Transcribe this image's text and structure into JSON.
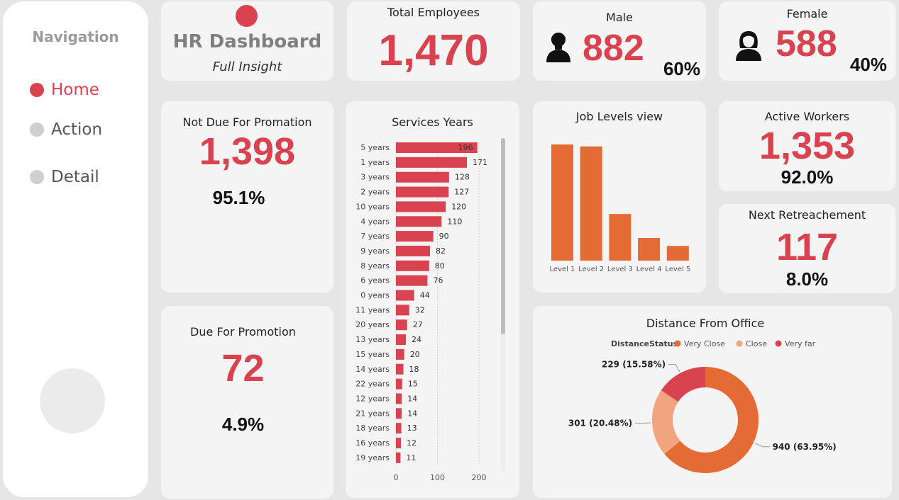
{
  "nav": {
    "title": "Navigation",
    "items": [
      {
        "label": "Home",
        "active": true
      },
      {
        "label": "Action",
        "active": false
      },
      {
        "label": "Detail",
        "active": false
      }
    ]
  },
  "header": {
    "title": "HR Dashboard",
    "subtitle": "Full Insight"
  },
  "total_employees": {
    "label": "Total Employees",
    "value": "1,470"
  },
  "male": {
    "label": "Male",
    "value": "882",
    "pct": "60%",
    "icon": "male-person-icon"
  },
  "female": {
    "label": "Female",
    "value": "588",
    "pct": "40%",
    "icon": "female-person-icon"
  },
  "not_due": {
    "label": "Not Due For Promation",
    "value": "1,398",
    "pct": "95.1%"
  },
  "due": {
    "label": "Due For Promotion",
    "value": "72",
    "pct": "4.9%"
  },
  "active_workers": {
    "label": "Active Workers",
    "value": "1,353",
    "pct": "92.0%"
  },
  "retirement": {
    "label": "Next Retreachement",
    "value": "117",
    "pct": "8.0%"
  },
  "colors": {
    "accent": "#d9434f",
    "orange": "#e56b35",
    "light_orange": "#f0a47f"
  },
  "chart_data": [
    {
      "type": "bar",
      "orientation": "horizontal",
      "title": "Services Years",
      "categories": [
        "5 years",
        "1 years",
        "3 years",
        "2 years",
        "10 years",
        "4 years",
        "7 years",
        "9 years",
        "8 years",
        "6 years",
        "0 years",
        "11 years",
        "20 years",
        "13 years",
        "15 years",
        "14 years",
        "22 years",
        "12 years",
        "21 years",
        "18 years",
        "16 years",
        "19 years"
      ],
      "values": [
        196,
        171,
        128,
        127,
        120,
        110,
        90,
        82,
        80,
        76,
        44,
        32,
        27,
        24,
        20,
        18,
        15,
        14,
        14,
        13,
        12,
        11
      ],
      "xticks": [
        0,
        100,
        200
      ],
      "xlim": [
        0,
        210
      ],
      "grid": true
    },
    {
      "type": "bar",
      "title": "Job Levels view",
      "categories": [
        "Level 1",
        "Level 2",
        "Level 3",
        "Level 4",
        "Level 5"
      ],
      "values": [
        543,
        534,
        218,
        106,
        69
      ]
    },
    {
      "type": "pie",
      "title": "Distance From Office",
      "legend_title": "DistanceStatus",
      "legend_position": "top",
      "slices": [
        {
          "name": "Very Close",
          "value": 940,
          "label": "940 (63.95%)",
          "color": "#e56b35"
        },
        {
          "name": "Close",
          "value": 301,
          "label": "301 (20.48%)",
          "color": "#f0a47f"
        },
        {
          "name": "Very far",
          "value": 229,
          "label": "229 (15.58%)",
          "color": "#d9434f"
        }
      ]
    }
  ]
}
